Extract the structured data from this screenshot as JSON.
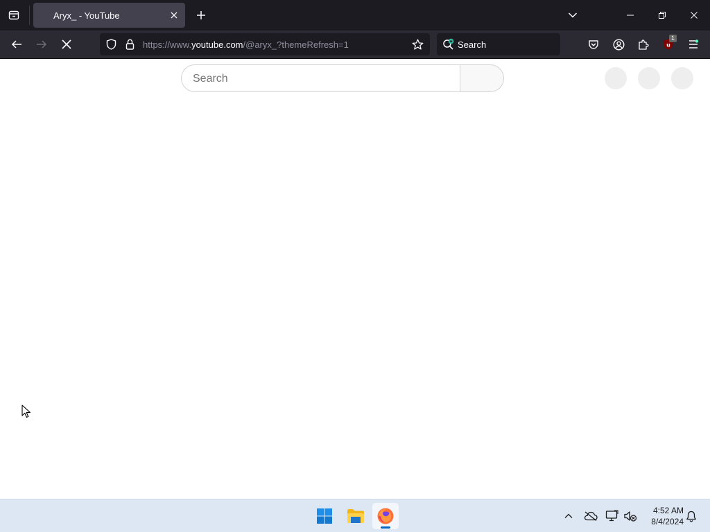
{
  "browser": {
    "tab": {
      "title": "Aryx_ - YouTube"
    },
    "urlbar": {
      "url_prefix": "https://www.",
      "url_host": "youtube.com",
      "url_path": "/@aryx_?themeRefresh=1"
    },
    "searchbar": {
      "label": "Search"
    },
    "extension_badge_count": "1"
  },
  "page": {
    "search": {
      "placeholder": "Search"
    }
  },
  "taskbar": {
    "apps": [
      "start-menu",
      "file-explorer",
      "firefox"
    ],
    "clock": {
      "time": "4:52 AM",
      "date": "8/4/2024"
    }
  },
  "colors": {
    "tab_strip": "#1c1b22",
    "nav_bar": "#2b2a33",
    "active_tab": "#42414d",
    "taskbar": "#dde6f3",
    "windows_accent": "#0067c0"
  }
}
